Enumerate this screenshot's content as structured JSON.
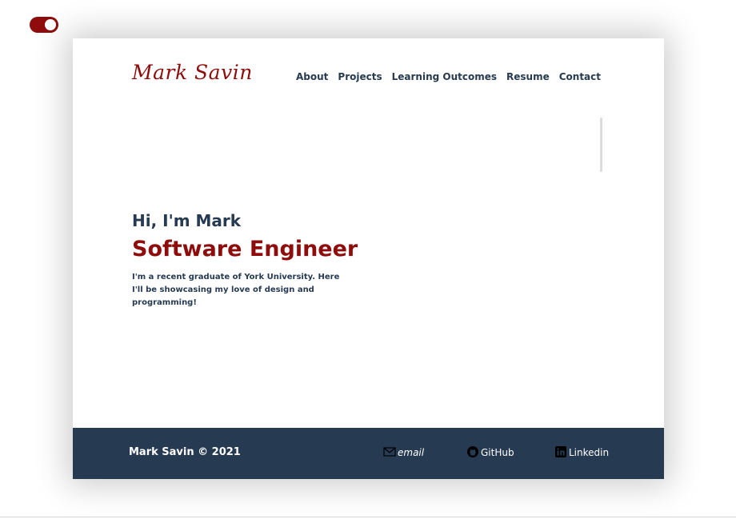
{
  "theme_toggle": {
    "state": "on",
    "accent_color": "#8f0c0c"
  },
  "header": {
    "logo_text": "Mark Savin",
    "nav": [
      {
        "label": "About"
      },
      {
        "label": "Projects"
      },
      {
        "label": "Learning Outcomes"
      },
      {
        "label": "Resume"
      },
      {
        "label": "Contact"
      }
    ]
  },
  "hero": {
    "greeting": "Hi, I'm Mark",
    "role": "Software Engineer",
    "intro": "I'm a recent graduate of York University. Here I'll be showcasing my love of design and programming!"
  },
  "footer": {
    "copyright": "Mark Savin © 2021",
    "links": [
      {
        "label": "email",
        "icon": "mail-icon"
      },
      {
        "label": "GitHub",
        "icon": "github-icon"
      },
      {
        "label": "Linkedin",
        "icon": "linkedin-icon"
      }
    ]
  },
  "colors": {
    "brand_red": "#8f0c0c",
    "navy": "#263a52",
    "background": "#ffffff"
  }
}
